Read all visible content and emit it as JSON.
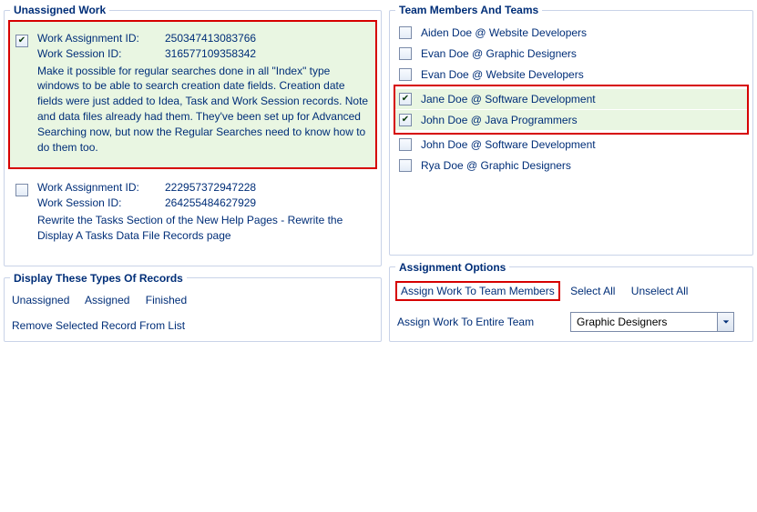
{
  "unassigned": {
    "legend": "Unassigned Work",
    "items": [
      {
        "checked": true,
        "selected": true,
        "assignment_label": "Work Assignment ID:",
        "assignment_id": "250347413083766",
        "session_label": "Work Session ID:",
        "session_id": "316577109358342",
        "desc": "Make it possible for regular searches done in all \"Index\" type windows to be able to search creation date fields. Creation date fields were just added to Idea, Task and Work Session records. Note and data files already had them. They've been set up for Advanced Searching now, but now the Regular Searches need to know how to do them too."
      },
      {
        "checked": false,
        "selected": false,
        "assignment_label": "Work Assignment ID:",
        "assignment_id": "222957372947228",
        "session_label": "Work Session ID:",
        "session_id": "264255484627929",
        "desc": "Rewrite the Tasks Section of the New Help Pages - Rewrite the Display A Tasks Data File Records page"
      }
    ]
  },
  "display_types": {
    "legend": "Display These Types Of Records",
    "links": [
      "Unassigned",
      "Assigned",
      "Finished"
    ],
    "remove_link": "Remove Selected Record From List"
  },
  "team_members": {
    "legend": "Team Members And Teams",
    "items": [
      {
        "label": "Aiden Doe @ Website Developers",
        "checked": false,
        "highlight": false
      },
      {
        "label": "Evan Doe @ Graphic Designers",
        "checked": false,
        "highlight": false
      },
      {
        "label": "Evan Doe @ Website Developers",
        "checked": false,
        "highlight": false
      },
      {
        "label": "Jane Doe @ Software Development",
        "checked": true,
        "highlight": true
      },
      {
        "label": "John Doe @ Java Programmers",
        "checked": true,
        "highlight": true
      },
      {
        "label": "John Doe @ Software Development",
        "checked": false,
        "highlight": false
      },
      {
        "label": "Rya Doe @ Graphic Designers",
        "checked": false,
        "highlight": false
      }
    ]
  },
  "assignment_options": {
    "legend": "Assignment Options",
    "assign_members": "Assign Work To Team Members",
    "select_all": "Select All",
    "unselect_all": "Unselect All",
    "assign_team_label": "Assign Work To Entire Team",
    "team_select_value": "Graphic Designers"
  }
}
